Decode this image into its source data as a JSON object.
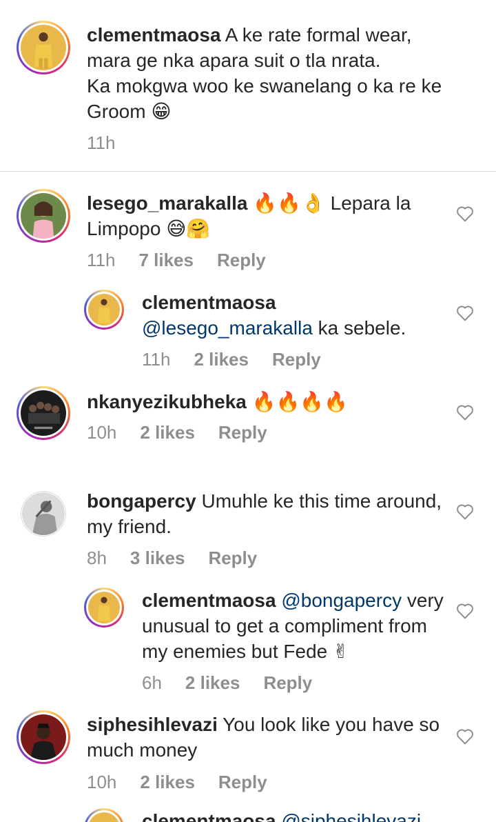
{
  "caption": {
    "username": "clementmaosa",
    "lines": [
      "A ke rate formal wear,",
      "mara ge nka apara suit o tla nrata.",
      "Ka mokgwa woo ke swanelang o ka re ke",
      "Groom"
    ],
    "emoji": "😁",
    "time": "11h"
  },
  "comments": [
    {
      "username": "lesego_marakalla",
      "emoji_lead": "🔥🔥👌",
      "text_1": "Lepara la",
      "text_2": "Limpopo",
      "emoji_tail": "😅🤗",
      "time": "11h",
      "likes": "7 likes",
      "reply": "Reply"
    },
    {
      "username": "clementmaosa",
      "mention": "@lesego_marakalla",
      "text": "ka sebele.",
      "time": "11h",
      "likes": "2 likes",
      "reply": "Reply"
    },
    {
      "username": "nkanyezikubheka",
      "emoji": "🔥🔥🔥🔥",
      "time": "10h",
      "likes": "2 likes",
      "reply": "Reply"
    },
    {
      "username": "bongapercy",
      "text_1": "Umuhle ke this time around,",
      "text_2": "my friend.",
      "time": "8h",
      "likes": "3 likes",
      "reply": "Reply"
    },
    {
      "username": "clementmaosa",
      "mention": "@bongapercy",
      "text_1": "very",
      "text_2": "unusual to get a compliment from",
      "text_3": "my enemies but Fede",
      "emoji": "✌",
      "time": "6h",
      "likes": "2 likes",
      "reply": "Reply"
    },
    {
      "username": "siphesihlevazi",
      "text_1": "You look like you have so",
      "text_2": "much money",
      "time": "10h",
      "likes": "2 likes",
      "reply": "Reply"
    },
    {
      "username": "clementmaosa",
      "mention": "@siphesihlevazi"
    }
  ],
  "colors": {
    "text": "#262626",
    "meta": "#8e8e8e",
    "mention": "#00376b",
    "divider": "#dbdbdb"
  },
  "icons": {
    "like": "heart-outline-icon"
  }
}
